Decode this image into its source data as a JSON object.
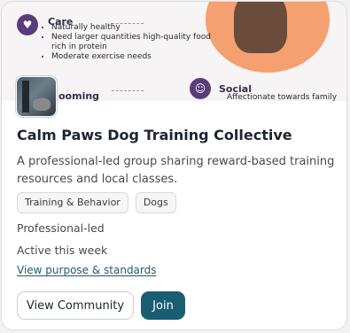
{
  "banner": {
    "care_heading": "Care",
    "care_items": [
      "Naturally healthy",
      "Need larger quantities high-quality food rich in protein",
      "Moderate exercise needs"
    ],
    "grooming_heading": "ooming",
    "social_heading": "Social",
    "social_item": "Affectionate towards family"
  },
  "community": {
    "title": "Calm Paws Dog Training Collective",
    "description": "A professional-led group sharing reward-based training resources and local classes.",
    "tags": [
      "Training & Behavior",
      "Dogs"
    ],
    "leadership": "Professional-led",
    "activity": "Active this week",
    "standards_link": "View purpose & standards"
  },
  "actions": {
    "view_label": "View Community",
    "join_label": "Join"
  },
  "colors": {
    "accent": "#195d73",
    "link": "#1f5a6e",
    "banner_icon": "#5b3b79",
    "banner_circle": "#f4a070"
  }
}
